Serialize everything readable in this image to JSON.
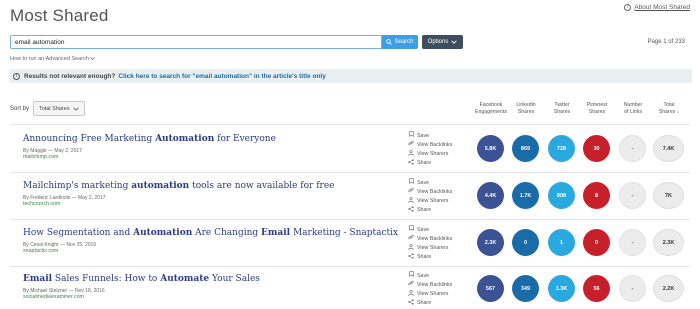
{
  "page": {
    "title": "Most Shared",
    "about_link": "About Most Shared",
    "page_info": "Page 1 of 233"
  },
  "search": {
    "value": "email automation",
    "button_label": "Search",
    "options_label": "Options",
    "howto_label": "How to run an Advanced Search"
  },
  "banner": {
    "prefix": "Results not relevant enough?",
    "link_text": "Click here to search for \"email automation\" in the article's title only"
  },
  "sort": {
    "label": "Sort by",
    "selected": "Total Shares"
  },
  "columns": {
    "facebook": [
      "Facebook",
      "Engagements"
    ],
    "linkedin": [
      "Linkedin",
      "Shares"
    ],
    "twitter": [
      "Twitter",
      "Shares"
    ],
    "pinterest": [
      "Pinterest",
      "Shares"
    ],
    "links": [
      "Number",
      "of Links"
    ],
    "total": [
      "Total",
      "Shares ↓"
    ]
  },
  "actions": {
    "save": "Save",
    "backlinks": "View Backlinks",
    "sharers": "View Sharers",
    "share": "Share"
  },
  "icons": {
    "info": "info-icon",
    "search": "search-icon",
    "options": "chevron-down-icon",
    "save": "bookmark-icon",
    "backlinks": "link-icon",
    "sharers": "people-icon",
    "share": "share-icon"
  },
  "colors": {
    "facebook": "#3b5394",
    "linkedin": "#1a6ca8",
    "twitter": "#2aa9e0",
    "pinterest": "#c8202b",
    "title_link": "#2a3a8a",
    "domain": "#3a8a3a",
    "search_button": "#3d9ee5",
    "options_button": "#3e4e60"
  },
  "articles": [
    {
      "title_parts": [
        {
          "text": "Announcing Free Marketing ",
          "bold": false
        },
        {
          "text": "Automation",
          "bold": true
        },
        {
          "text": " for Everyone",
          "bold": false
        }
      ],
      "meta": "By Maggie — May 2, 2017",
      "domain": "mailchimp.com",
      "facebook": "5.8K",
      "linkedin": "869",
      "twitter": "728",
      "pinterest": "30",
      "links": "-",
      "total": "7.4K"
    },
    {
      "title_parts": [
        {
          "text": "Mailchimp's marketing ",
          "bold": false
        },
        {
          "text": "automation",
          "bold": true
        },
        {
          "text": " tools are now available for free",
          "bold": false
        }
      ],
      "meta": "By Frederic Lardinois — May 2, 2017",
      "domain": "techcrunch.com",
      "facebook": "4.4K",
      "linkedin": "1.7K",
      "twitter": "808",
      "pinterest": "8",
      "links": "-",
      "total": "7K"
    },
    {
      "title_parts": [
        {
          "text": "How Segmentation and ",
          "bold": false
        },
        {
          "text": "Automation",
          "bold": true
        },
        {
          "text": " Are Changing ",
          "bold": false
        },
        {
          "text": "Email",
          "bold": true
        },
        {
          "text": " Marketing - Snaptactix",
          "bold": false
        }
      ],
      "meta": "By Cesai Knight — Nov 25, 2016",
      "domain": "snaptactix.com",
      "facebook": "2.3K",
      "linkedin": "0",
      "twitter": "1",
      "pinterest": "0",
      "links": "-",
      "total": "2.3K"
    },
    {
      "title_parts": [
        {
          "text": "Email",
          "bold": true
        },
        {
          "text": " Sales Funnels: How to ",
          "bold": false
        },
        {
          "text": "Automate",
          "bold": true
        },
        {
          "text": " Your Sales",
          "bold": false
        }
      ],
      "meta": "By Michael Stelzner — Nov 18, 2016",
      "domain": "socialmediaexaminer.com",
      "facebook": "567",
      "linkedin": "349",
      "twitter": "1.3K",
      "pinterest": "56",
      "links": "-",
      "total": "2.2K"
    }
  ]
}
